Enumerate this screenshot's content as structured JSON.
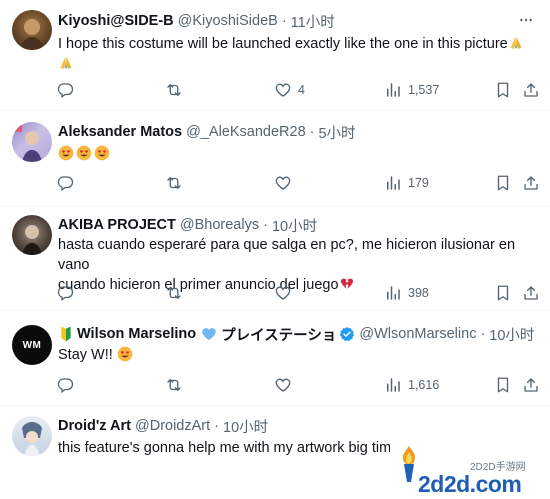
{
  "tweets": [
    {
      "name": "Kiyoshi@SIDE-B",
      "handle": "@KiyoshiSideB",
      "time": "11小时",
      "text_line1": "I hope this costume will be launched exactly like the one in this picture",
      "replies": "",
      "retweets": "",
      "likes": "4",
      "views": "1,537"
    },
    {
      "name": "Aleksander Matos",
      "handle": "@_AleKsandeR28",
      "time": "5小时",
      "replies": "",
      "retweets": "",
      "likes": "",
      "views": "179"
    },
    {
      "name": "AKIBA PROJECT",
      "handle": "@Bhorealys",
      "time": "10小时",
      "text_line1": "hasta cuando esperaré para que salga en pc?, me hicieron ilusionar en vano",
      "text_line2": "cuando hicieron el primer anuncio del juego",
      "replies": "",
      "retweets": "",
      "likes": "",
      "views": "398"
    },
    {
      "name": "Wilson Marselino",
      "name_suffix": "プレイステーショ",
      "handle": "@WlsonMarselinc",
      "time": "10小时",
      "text_line1": "Stay W!!",
      "replies": "",
      "retweets": "",
      "likes": "",
      "views": "1,616",
      "avatar_text": "WM"
    },
    {
      "name": "Droid'z Art",
      "handle": "@DroidzArt",
      "time": "10小时",
      "text_line1": "this feature's gonna help me with my artwork big tim"
    }
  ],
  "separator": "·",
  "watermark": {
    "top": "2D2D手游网",
    "main": "2d2d.com"
  },
  "icons": {
    "reply": "reply-icon",
    "retweet": "retweet-icon",
    "like": "heart-icon",
    "views": "views-icon",
    "bookmark": "bookmark-icon",
    "share": "share-icon",
    "more": "more-icon"
  },
  "colors": {
    "text": "#0f1419",
    "secondary": "#536471",
    "divider": "#eff3f4",
    "verified": "#1d9bf0"
  }
}
